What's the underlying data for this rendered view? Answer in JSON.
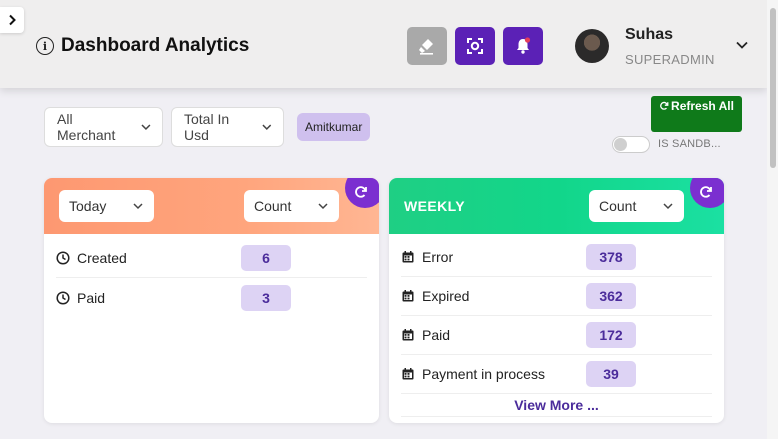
{
  "header": {
    "title": "Dashboard Analytics",
    "user": {
      "name": "Suhas",
      "role": "SUPERADMIN"
    }
  },
  "filters": {
    "merchant": "All Merchant",
    "currency": "Total In Usd",
    "chip": "Amitkumar"
  },
  "actions": {
    "refresh_all": "Refresh All",
    "sandbox_label": "IS SANDB..."
  },
  "today_card": {
    "period": "Today",
    "metric": "Count",
    "rows": [
      {
        "label": "Created",
        "value": "6"
      },
      {
        "label": "Paid",
        "value": "3"
      }
    ]
  },
  "weekly_card": {
    "title": "WEEKLY",
    "metric": "Count",
    "rows": [
      {
        "label": "Error",
        "value": "378"
      },
      {
        "label": "Expired",
        "value": "362"
      },
      {
        "label": "Paid",
        "value": "172"
      },
      {
        "label": "Payment in process",
        "value": "39"
      }
    ],
    "view_more": "View More ..."
  },
  "colors": {
    "accent_purple": "#5b21b6",
    "refresh_green": "#0f7a1a",
    "today_header": "#fd9871",
    "weekly_header": "#12d68a",
    "badge_bg": "#ddd3f4"
  }
}
